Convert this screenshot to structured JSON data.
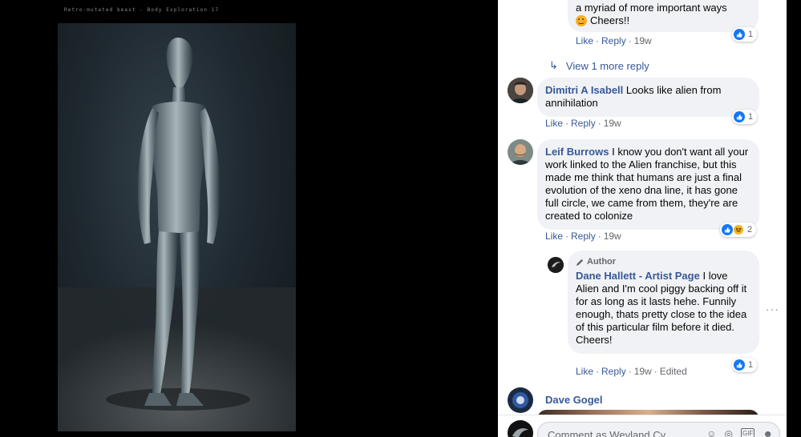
{
  "viewer": {
    "caption": "Retro-mutated beast - Body Exploration 17"
  },
  "comments": {
    "top_reply": {
      "lines": [
        "a myriad of more important ways",
        "Cheers!!"
      ],
      "actions": [
        "Like",
        "Reply",
        "19w"
      ],
      "reactions": "1"
    },
    "view_more": "View 1 more reply",
    "items": [
      {
        "name": "Dimitri A Isabell",
        "text": "Looks like alien from annihilation",
        "actions": [
          "Like",
          "Reply",
          "19w"
        ],
        "reactions": "1"
      },
      {
        "name": "Leif Burrows",
        "text": "I know you don't want all your work linked to the Alien franchise, but this made me think that humans are just a final evolution of the xeno dna line, it has gone full circle, we came from them, they're are created to colonize",
        "actions": [
          "Like",
          "Reply",
          "19w"
        ],
        "reactions": "2"
      }
    ],
    "author_reply": {
      "badge": "Author",
      "name": "Dane Hallett - Artist Page",
      "text": "I love Alien and I'm cool piggy backing off it for as long as it lasts hehe. Funnily enough, thats pretty close to the idea of this particular film before it died.",
      "closing": "Cheers!",
      "actions": [
        "Like",
        "Reply",
        "19w",
        "Edited"
      ],
      "reactions": "1"
    },
    "last": {
      "name": "Dave Gogel"
    },
    "composer": {
      "placeholder": "Comment as Weyland Cy..."
    }
  },
  "colors": {
    "link": "#385898",
    "bubble": "#f0f2f5",
    "like_blue": "#1877f2"
  }
}
